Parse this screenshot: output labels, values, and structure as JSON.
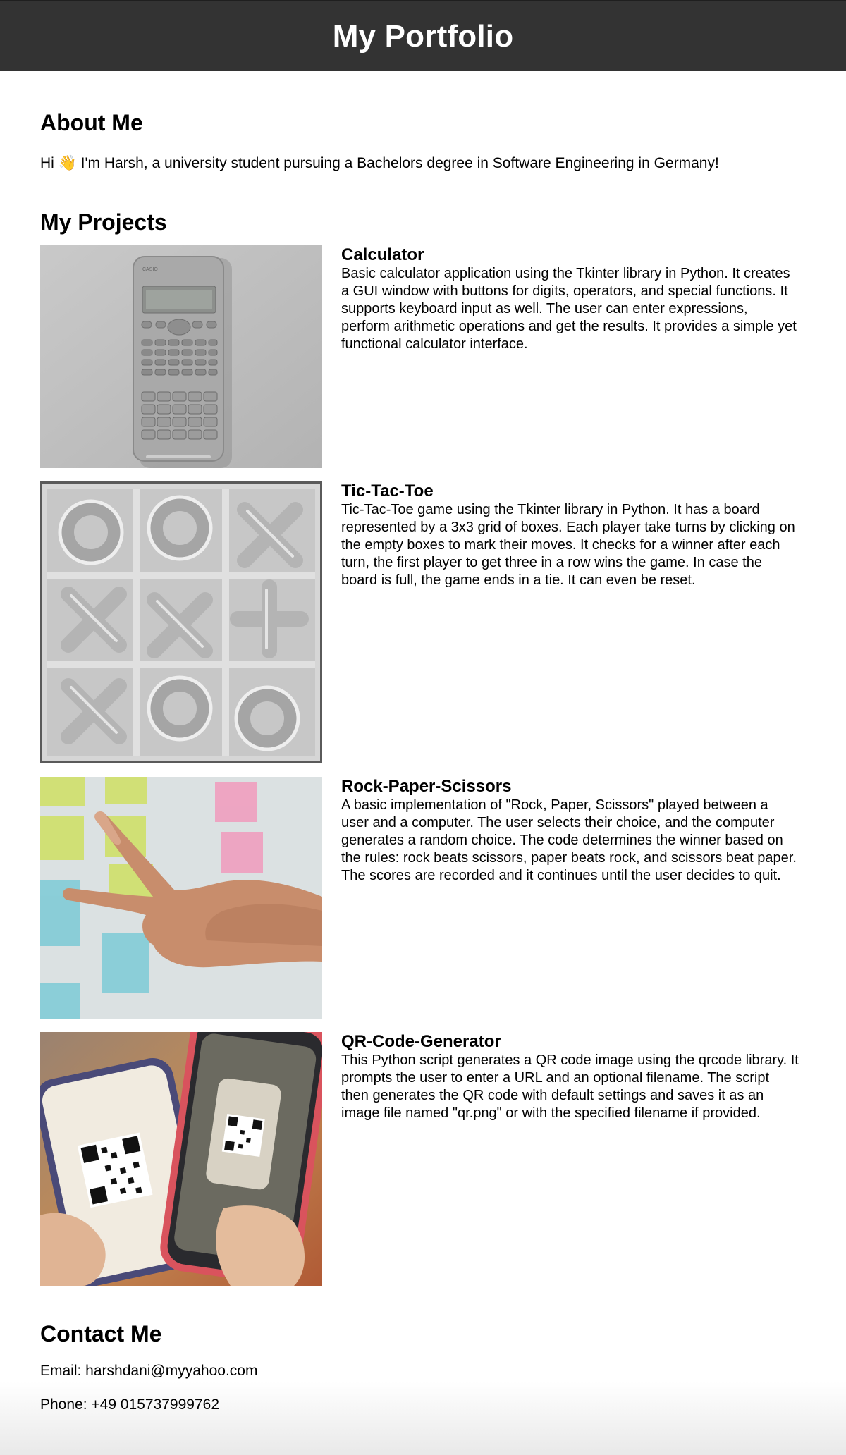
{
  "header": {
    "title": "My Portfolio"
  },
  "about": {
    "heading": "About Me",
    "text": "Hi 👋 I'm Harsh, a university student pursuing a Bachelors degree in Software Engineering in Germany!"
  },
  "projects": {
    "heading": "My Projects",
    "items": [
      {
        "title": "Calculator",
        "description": "Basic calculator application using the Tkinter library in Python. It creates a GUI window with buttons for digits, operators, and special functions. It supports keyboard input as well. The user can enter expressions, perform arithmetic operations and get the results. It provides a simple yet functional calculator interface.",
        "image": "calculator-photo"
      },
      {
        "title": "Tic-Tac-Toe",
        "description": "Tic-Tac-Toe game using the Tkinter library in Python. It has a board represented by a 3x3 grid of boxes. Each player take turns by clicking on the empty boxes to mark their moves. It checks for a winner after each turn, the first player to get three in a row wins the game. In case the board is full, the game ends in a tie. It can even be reset.",
        "image": "tic-tac-toe-board-photo"
      },
      {
        "title": "Rock-Paper-Scissors",
        "description": "A basic implementation of \"Rock, Paper, Scissors\" played between a user and a computer. The user selects their choice, and the computer generates a random choice. The code determines the winner based on the rules: rock beats scissors, paper beats rock, and scissors beat paper. The scores are recorded and it continues until the user decides to quit.",
        "image": "hand-scissors-photo"
      },
      {
        "title": "QR-Code-Generator",
        "description": "This Python script generates a QR code image using the qrcode library. It prompts the user to enter a URL and an optional filename. The script then generates the QR code with default settings and saves it as an image file named \"qr.png\" or with the specified filename if provided.",
        "image": "phones-qr-code-photo"
      }
    ]
  },
  "contact": {
    "heading": "Contact Me",
    "email": "Email: harshdani@myyahoo.com",
    "phone": "Phone: +49 015737999762"
  }
}
